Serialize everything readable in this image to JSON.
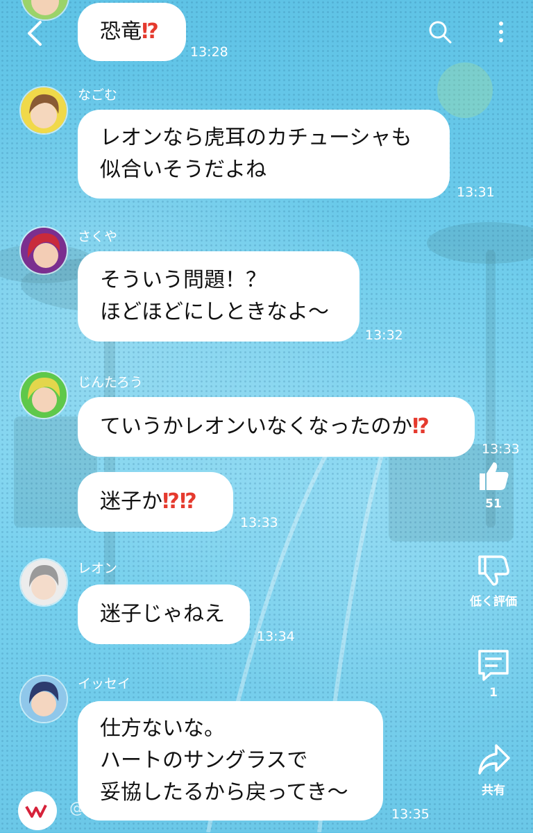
{
  "header": {
    "back_icon": "chevron-left-icon",
    "search_icon": "search-icon",
    "menu_icon": "more-vertical-icon"
  },
  "messages": [
    {
      "name": "",
      "lines": [
        "恐竜"
      ],
      "emoji": "⁉",
      "time": "13:28"
    },
    {
      "name": "なごむ",
      "lines": [
        "レオンなら虎耳のカチューシャも",
        "似合いそうだよね"
      ],
      "time": "13:31"
    },
    {
      "name": "さくや",
      "lines": [
        "そういう問題！？",
        "ほどほどにしときなよ〜"
      ],
      "time": "13:32"
    },
    {
      "name": "じんたろう",
      "lines": [
        "ていうかレオンいなくなったのか"
      ],
      "emoji": "⁉",
      "time": "13:33"
    },
    {
      "name": "",
      "lines": [
        "迷子か"
      ],
      "emoji": "⁉⁉",
      "time": "13:33"
    },
    {
      "name": "レオン",
      "lines": [
        "迷子じゃねえ"
      ],
      "time": "13:34"
    },
    {
      "name": "イッセイ",
      "lines": [
        "仕方ないな。",
        "ハートのサングラスで",
        "妥協したるから戻ってき〜"
      ],
      "time": "13:35"
    }
  ],
  "rail": {
    "like_count": "51",
    "dislike_label": "低く評価",
    "comment_count": "1",
    "share_label": "共有"
  },
  "watermark": "@vsa_official_jp"
}
